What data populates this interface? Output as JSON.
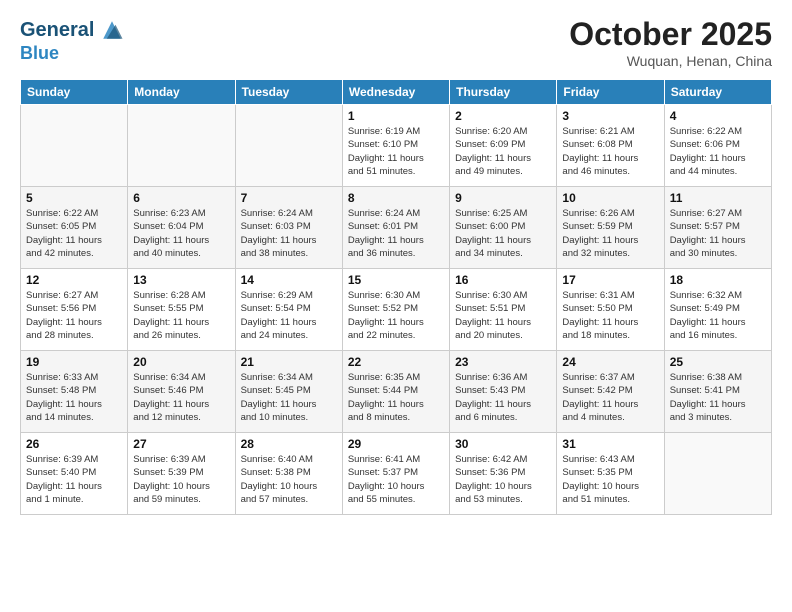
{
  "header": {
    "logo_line1": "General",
    "logo_line2": "Blue",
    "month_title": "October 2025",
    "location": "Wuquan, Henan, China"
  },
  "weekdays": [
    "Sunday",
    "Monday",
    "Tuesday",
    "Wednesday",
    "Thursday",
    "Friday",
    "Saturday"
  ],
  "weeks": [
    [
      {
        "day": "",
        "info": ""
      },
      {
        "day": "",
        "info": ""
      },
      {
        "day": "",
        "info": ""
      },
      {
        "day": "1",
        "info": "Sunrise: 6:19 AM\nSunset: 6:10 PM\nDaylight: 11 hours\nand 51 minutes."
      },
      {
        "day": "2",
        "info": "Sunrise: 6:20 AM\nSunset: 6:09 PM\nDaylight: 11 hours\nand 49 minutes."
      },
      {
        "day": "3",
        "info": "Sunrise: 6:21 AM\nSunset: 6:08 PM\nDaylight: 11 hours\nand 46 minutes."
      },
      {
        "day": "4",
        "info": "Sunrise: 6:22 AM\nSunset: 6:06 PM\nDaylight: 11 hours\nand 44 minutes."
      }
    ],
    [
      {
        "day": "5",
        "info": "Sunrise: 6:22 AM\nSunset: 6:05 PM\nDaylight: 11 hours\nand 42 minutes."
      },
      {
        "day": "6",
        "info": "Sunrise: 6:23 AM\nSunset: 6:04 PM\nDaylight: 11 hours\nand 40 minutes."
      },
      {
        "day": "7",
        "info": "Sunrise: 6:24 AM\nSunset: 6:03 PM\nDaylight: 11 hours\nand 38 minutes."
      },
      {
        "day": "8",
        "info": "Sunrise: 6:24 AM\nSunset: 6:01 PM\nDaylight: 11 hours\nand 36 minutes."
      },
      {
        "day": "9",
        "info": "Sunrise: 6:25 AM\nSunset: 6:00 PM\nDaylight: 11 hours\nand 34 minutes."
      },
      {
        "day": "10",
        "info": "Sunrise: 6:26 AM\nSunset: 5:59 PM\nDaylight: 11 hours\nand 32 minutes."
      },
      {
        "day": "11",
        "info": "Sunrise: 6:27 AM\nSunset: 5:57 PM\nDaylight: 11 hours\nand 30 minutes."
      }
    ],
    [
      {
        "day": "12",
        "info": "Sunrise: 6:27 AM\nSunset: 5:56 PM\nDaylight: 11 hours\nand 28 minutes."
      },
      {
        "day": "13",
        "info": "Sunrise: 6:28 AM\nSunset: 5:55 PM\nDaylight: 11 hours\nand 26 minutes."
      },
      {
        "day": "14",
        "info": "Sunrise: 6:29 AM\nSunset: 5:54 PM\nDaylight: 11 hours\nand 24 minutes."
      },
      {
        "day": "15",
        "info": "Sunrise: 6:30 AM\nSunset: 5:52 PM\nDaylight: 11 hours\nand 22 minutes."
      },
      {
        "day": "16",
        "info": "Sunrise: 6:30 AM\nSunset: 5:51 PM\nDaylight: 11 hours\nand 20 minutes."
      },
      {
        "day": "17",
        "info": "Sunrise: 6:31 AM\nSunset: 5:50 PM\nDaylight: 11 hours\nand 18 minutes."
      },
      {
        "day": "18",
        "info": "Sunrise: 6:32 AM\nSunset: 5:49 PM\nDaylight: 11 hours\nand 16 minutes."
      }
    ],
    [
      {
        "day": "19",
        "info": "Sunrise: 6:33 AM\nSunset: 5:48 PM\nDaylight: 11 hours\nand 14 minutes."
      },
      {
        "day": "20",
        "info": "Sunrise: 6:34 AM\nSunset: 5:46 PM\nDaylight: 11 hours\nand 12 minutes."
      },
      {
        "day": "21",
        "info": "Sunrise: 6:34 AM\nSunset: 5:45 PM\nDaylight: 11 hours\nand 10 minutes."
      },
      {
        "day": "22",
        "info": "Sunrise: 6:35 AM\nSunset: 5:44 PM\nDaylight: 11 hours\nand 8 minutes."
      },
      {
        "day": "23",
        "info": "Sunrise: 6:36 AM\nSunset: 5:43 PM\nDaylight: 11 hours\nand 6 minutes."
      },
      {
        "day": "24",
        "info": "Sunrise: 6:37 AM\nSunset: 5:42 PM\nDaylight: 11 hours\nand 4 minutes."
      },
      {
        "day": "25",
        "info": "Sunrise: 6:38 AM\nSunset: 5:41 PM\nDaylight: 11 hours\nand 3 minutes."
      }
    ],
    [
      {
        "day": "26",
        "info": "Sunrise: 6:39 AM\nSunset: 5:40 PM\nDaylight: 11 hours\nand 1 minute."
      },
      {
        "day": "27",
        "info": "Sunrise: 6:39 AM\nSunset: 5:39 PM\nDaylight: 10 hours\nand 59 minutes."
      },
      {
        "day": "28",
        "info": "Sunrise: 6:40 AM\nSunset: 5:38 PM\nDaylight: 10 hours\nand 57 minutes."
      },
      {
        "day": "29",
        "info": "Sunrise: 6:41 AM\nSunset: 5:37 PM\nDaylight: 10 hours\nand 55 minutes."
      },
      {
        "day": "30",
        "info": "Sunrise: 6:42 AM\nSunset: 5:36 PM\nDaylight: 10 hours\nand 53 minutes."
      },
      {
        "day": "31",
        "info": "Sunrise: 6:43 AM\nSunset: 5:35 PM\nDaylight: 10 hours\nand 51 minutes."
      },
      {
        "day": "",
        "info": ""
      }
    ]
  ]
}
